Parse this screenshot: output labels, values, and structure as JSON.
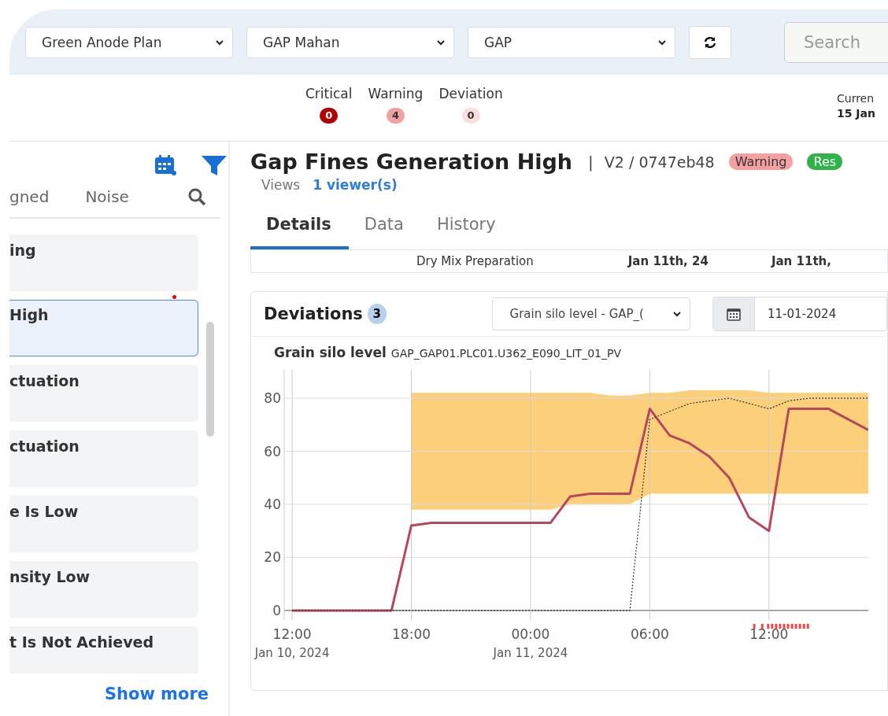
{
  "filters": {
    "selects": [
      {
        "value": "Green Anode Plan"
      },
      {
        "value": "GAP Mahan"
      },
      {
        "value": "GAP"
      }
    ],
    "search": {
      "placeholder": "Search"
    }
  },
  "status_counts": [
    {
      "label": "Critical",
      "count": "0",
      "color": "#b00000"
    },
    {
      "label": "Warning",
      "count": "4",
      "color": "#f5a0a0"
    },
    {
      "label": "Deviation",
      "count": "0",
      "color": "#f9dede"
    }
  ],
  "current": {
    "label": "Curren",
    "value": "15 Jan"
  },
  "sidebar": {
    "tabs": [
      {
        "label": "gned",
        "selected": false
      },
      {
        "label": "Noise",
        "selected": false
      }
    ],
    "items": [
      {
        "title": "ing",
        "selected": false,
        "unread": false
      },
      {
        "title": "High",
        "selected": true,
        "unread": true
      },
      {
        "title": "ctuation",
        "selected": false,
        "unread": false
      },
      {
        "title": "ctuation",
        "selected": false,
        "unread": false
      },
      {
        "title": "e Is Low",
        "selected": false,
        "unread": false
      },
      {
        "title": "nsity Low",
        "selected": false,
        "unread": false
      },
      {
        "title": "t Is Not Achieved",
        "selected": false,
        "unread": false
      }
    ],
    "show_more": "Show more"
  },
  "detail": {
    "title": "Gap Fines Generation High",
    "separator": "|",
    "version": "V2 / 0747eb48",
    "badges": [
      {
        "label": "Warning",
        "color": "#f5a0a0"
      },
      {
        "label": "Res",
        "color": "#2fb24a"
      }
    ],
    "views_label": "Views",
    "viewers": "1 viewer(s)",
    "tabs": [
      {
        "label": "Details",
        "selected": true
      },
      {
        "label": "Data",
        "selected": false
      },
      {
        "label": "History",
        "selected": false
      }
    ],
    "row": {
      "process": "Dry Mix Preparation",
      "start": "Jan 11th, 24",
      "end": "Jan 11th,"
    },
    "deviations": {
      "title": "Deviations",
      "count": "3",
      "tag_select": "Grain silo level - GAP_(",
      "date": "11-01-2024",
      "chart_title": "Grain silo level",
      "chart_tag": "GAP_GAP01.PLC01.U362_E090_LIT_01_PV",
      "chart_data": {
        "type": "line",
        "ylim": [
          -3.6,
          90.7
        ],
        "grid": true,
        "yticks": [
          0,
          20,
          40,
          60,
          80
        ],
        "categories": [
          "12:00\nJan 10, 2024",
          null,
          null,
          null,
          null,
          null,
          "18:00",
          null,
          null,
          null,
          null,
          null,
          "00:00\nJan 11, 2024",
          null,
          null,
          null,
          null,
          null,
          "06:00",
          null,
          null,
          null,
          null,
          null,
          "12:00",
          null,
          null,
          null,
          null,
          null
        ],
        "series": [
          {
            "type": "area",
            "color": "#fccf7a",
            "values": [
              null,
              null,
              null,
              null,
              null,
              null,
              82,
              82,
              82,
              82,
              82,
              82,
              82,
              82,
              82,
              82,
              81,
              81,
              82,
              82,
              83,
              83,
              83,
              83,
              82,
              82,
              82,
              82,
              82,
              82
            ]
          },
          {
            "type": "area",
            "color": "#ffffff",
            "values": [
              null,
              null,
              null,
              null,
              null,
              null,
              38,
              38,
              38,
              38,
              38,
              38,
              38,
              38,
              40,
              40,
              40,
              40,
              44,
              44,
              44,
              44,
              44,
              44,
              44,
              44,
              44,
              44,
              44,
              44
            ]
          },
          {
            "type": "line",
            "line_style": "solid",
            "color": "#b5485a",
            "values": [
              0,
              0,
              0,
              0,
              0,
              0,
              32,
              33,
              33,
              33,
              33,
              33,
              33,
              33,
              43,
              44,
              44,
              44,
              76,
              66,
              63,
              58,
              50,
              35,
              30,
              76,
              76,
              76,
              72,
              68
            ]
          },
          {
            "type": "line",
            "line_style": "dashed",
            "color": "#333333",
            "values": [
              0,
              0,
              0,
              0,
              0,
              0,
              0,
              0,
              0,
              0,
              0,
              0,
              0,
              0,
              0,
              0,
              0,
              0,
              72,
              75,
              78,
              79,
              80,
              78,
              76,
              79,
              80,
              80,
              80,
              80
            ]
          }
        ]
      }
    }
  }
}
